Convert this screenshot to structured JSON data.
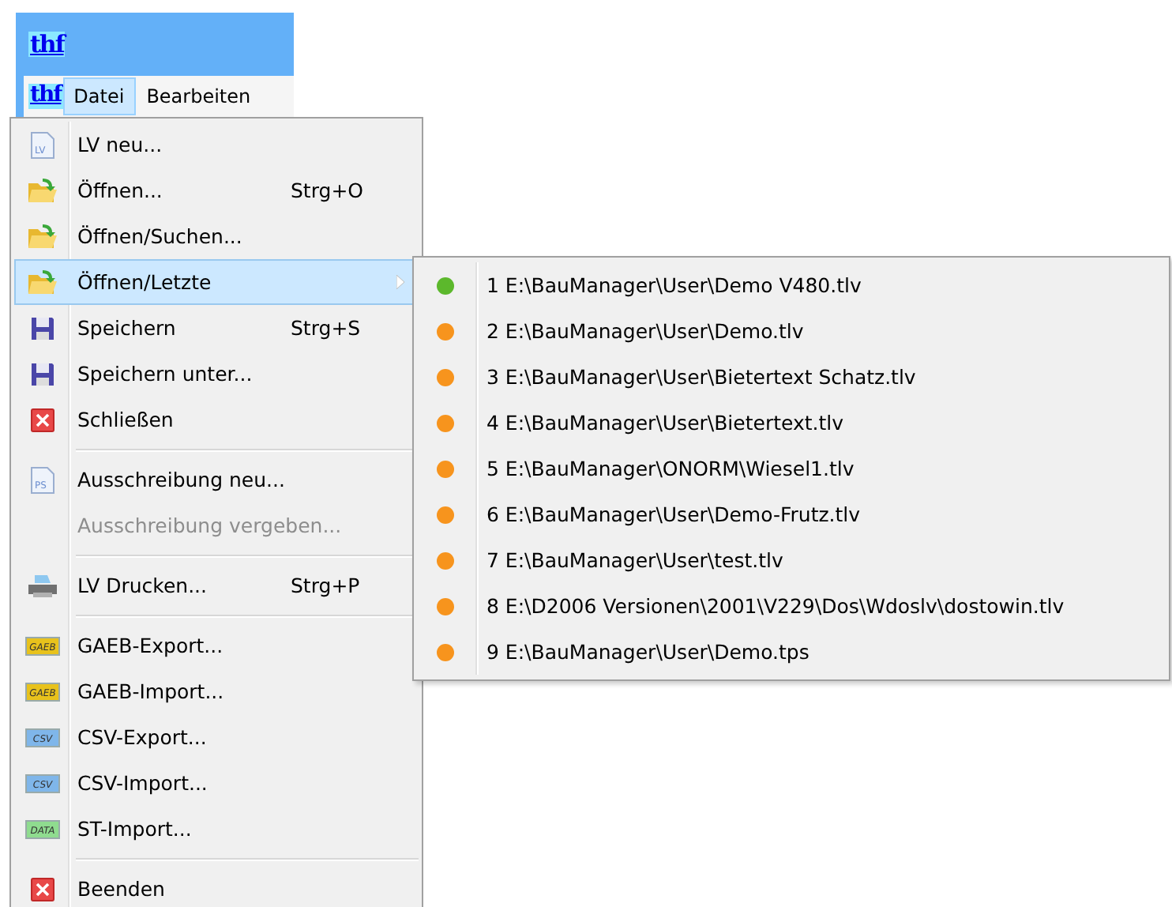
{
  "title_bar": {
    "logo": "thf"
  },
  "menu_bar": {
    "logo": "thf",
    "menus": [
      {
        "label": "Datei",
        "selected": true
      },
      {
        "label": "Bearbeiten",
        "selected": false
      }
    ]
  },
  "file_menu": {
    "items": [
      {
        "kind": "item",
        "icon_text": "LV",
        "label": "LV neu...",
        "disabled": false,
        "selected": false
      },
      {
        "kind": "item",
        "label": "Öffnen...",
        "shortcut": "Strg+O",
        "disabled": false,
        "selected": false
      },
      {
        "kind": "item",
        "label": "Öffnen/Suchen...",
        "disabled": false,
        "selected": false
      },
      {
        "kind": "item",
        "label": "Öffnen/Letzte",
        "has_submenu": true,
        "disabled": false,
        "selected": true
      },
      {
        "kind": "item",
        "label": "Speichern",
        "shortcut": "Strg+S",
        "disabled": false,
        "selected": false
      },
      {
        "kind": "item",
        "label": "Speichern unter...",
        "disabled": false,
        "selected": false
      },
      {
        "kind": "item",
        "label": "Schließen",
        "disabled": false,
        "selected": false
      },
      {
        "kind": "separator"
      },
      {
        "kind": "item",
        "icon_text": "PS",
        "label": "Ausschreibung neu...",
        "disabled": false,
        "selected": false
      },
      {
        "kind": "item",
        "label": "Ausschreibung vergeben...",
        "disabled": true,
        "selected": false
      },
      {
        "kind": "separator"
      },
      {
        "kind": "item",
        "label": "LV Drucken...",
        "shortcut": "Strg+P",
        "disabled": false,
        "selected": false
      },
      {
        "kind": "separator"
      },
      {
        "kind": "item",
        "icon_text": "GAEB",
        "label": "GAEB-Export...",
        "disabled": false,
        "selected": false
      },
      {
        "kind": "item",
        "icon_text": "GAEB",
        "label": "GAEB-Import...",
        "disabled": false,
        "selected": false
      },
      {
        "kind": "item",
        "icon_text": "CSV",
        "label": "CSV-Export...",
        "disabled": false,
        "selected": false
      },
      {
        "kind": "item",
        "icon_text": "CSV",
        "label": "CSV-Import...",
        "disabled": false,
        "selected": false
      },
      {
        "kind": "item",
        "icon_text": "DATA",
        "label": "ST-Import...",
        "disabled": false,
        "selected": false
      },
      {
        "kind": "separator"
      },
      {
        "kind": "item",
        "label": "Beenden",
        "disabled": false,
        "selected": false
      }
    ]
  },
  "recent_submenu": {
    "items": [
      {
        "label": "1 E:\\BauManager\\User\\Demo V480.tlv",
        "color": "#5cb82c"
      },
      {
        "label": "2 E:\\BauManager\\User\\Demo.tlv",
        "color": "#f7941d"
      },
      {
        "label": "3 E:\\BauManager\\User\\Bietertext Schatz.tlv",
        "color": "#f7941d"
      },
      {
        "label": "4 E:\\BauManager\\User\\Bietertext.tlv",
        "color": "#f7941d"
      },
      {
        "label": "5 E:\\BauManager\\ONORM\\Wiesel1.tlv",
        "color": "#f7941d"
      },
      {
        "label": "6 E:\\BauManager\\User\\Demo-Frutz.tlv",
        "color": "#f7941d"
      },
      {
        "label": "7 E:\\BauManager\\User\\test.tlv",
        "color": "#f7941d"
      },
      {
        "label": "8 E:\\D2006 Versionen\\2001\\V229\\Dos\\Wdoslv\\dostowin.tlv",
        "color": "#f7941d"
      },
      {
        "label": "9 E:\\BauManager\\User\\Demo.tps",
        "color": "#f7941d"
      }
    ]
  }
}
